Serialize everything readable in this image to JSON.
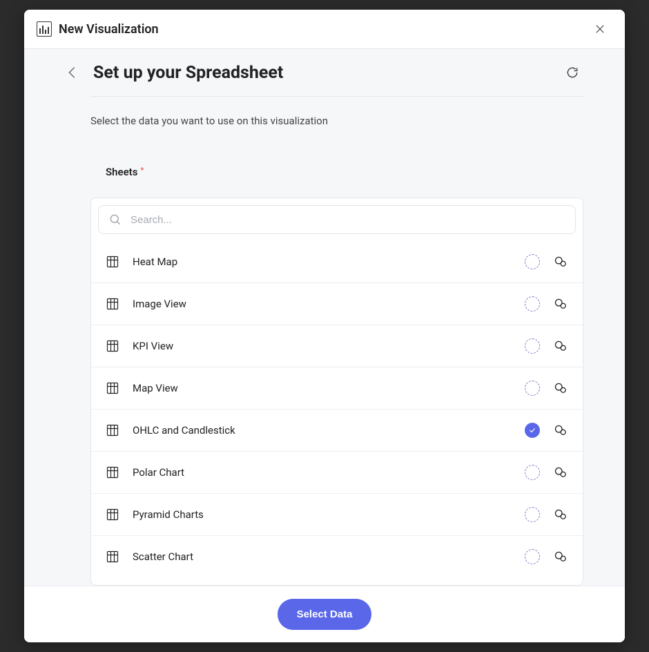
{
  "header": {
    "title": "New Visualization"
  },
  "page": {
    "back_visible": true,
    "title": "Set up your Spreadsheet",
    "description": "Select the data you want to use on this visualization",
    "sheets_label": "Sheets"
  },
  "search": {
    "placeholder": "Search..."
  },
  "sheets": [
    {
      "label": "Heat Map",
      "selected": false
    },
    {
      "label": "Image View",
      "selected": false
    },
    {
      "label": "KPI View",
      "selected": false
    },
    {
      "label": "Map View",
      "selected": false
    },
    {
      "label": "OHLC and Candlestick",
      "selected": true
    },
    {
      "label": "Polar Chart",
      "selected": false
    },
    {
      "label": "Pyramid Charts",
      "selected": false
    },
    {
      "label": "Scatter Chart",
      "selected": false
    }
  ],
  "footer": {
    "primary_label": "Select Data"
  }
}
